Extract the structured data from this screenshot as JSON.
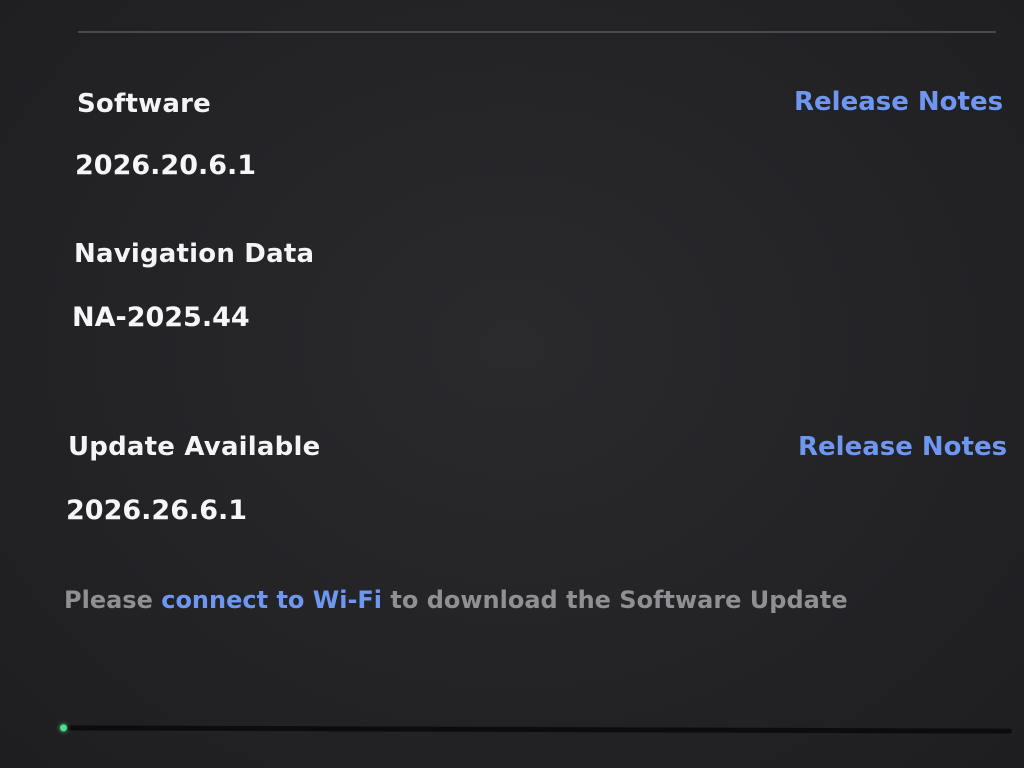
{
  "software": {
    "label": "Software",
    "version": "2026.20.6.1",
    "release_notes_label": "Release Notes"
  },
  "navigation": {
    "label": "Navigation Data",
    "version": "NA-2025.44"
  },
  "update": {
    "label": "Update Available",
    "version": "2026.26.6.1",
    "release_notes_label": "Release Notes",
    "notice_prefix": "Please ",
    "notice_link": "connect to Wi-Fi",
    "notice_suffix": " to download the Software Update",
    "progress_fraction": 0.005
  },
  "colors": {
    "link": "#6f97f2",
    "progress": "#3ad27a",
    "notice_text": "#8f8f94"
  }
}
